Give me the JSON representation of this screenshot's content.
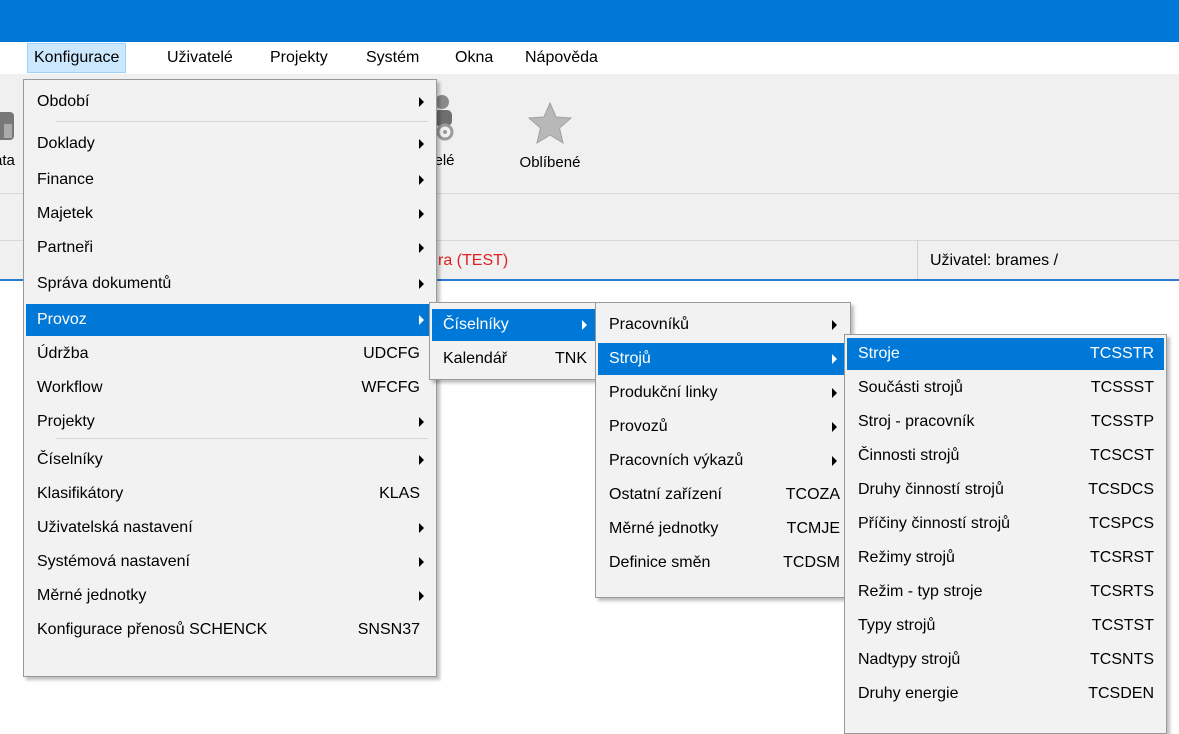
{
  "menubar": {
    "items": [
      "Konfigurace",
      "Uživatelé",
      "Projekty",
      "Systém",
      "Okna",
      "Nápověda"
    ]
  },
  "toolbar": {
    "left_partial": "ata",
    "users_partial": "atelé",
    "favorites": "Oblíbené"
  },
  "status": {
    "company_partial": "ra (TEST)",
    "user": "Uživatel: brames /"
  },
  "menu1": [
    {
      "label": "Období",
      "submenu": true
    },
    {
      "label": "Doklady",
      "submenu": true
    },
    {
      "label": "Finance",
      "submenu": true
    },
    {
      "label": "Majetek",
      "submenu": true
    },
    {
      "label": "Partneři",
      "submenu": true
    },
    {
      "label": "Správa dokumentů",
      "submenu": true
    },
    {
      "label": "Provoz",
      "submenu": true,
      "selected": true
    },
    {
      "label": "Údržba",
      "shortcut": "UDCFG"
    },
    {
      "label": "Workflow",
      "shortcut": "WFCFG"
    },
    {
      "label": "Projekty",
      "submenu": true
    },
    {
      "label": "Číselníky",
      "submenu": true
    },
    {
      "label": "Klasifikátory",
      "shortcut": "KLAS"
    },
    {
      "label": "Uživatelská nastavení",
      "submenu": true
    },
    {
      "label": "Systémová nastavení",
      "submenu": true
    },
    {
      "label": "Měrné jednotky",
      "submenu": true
    },
    {
      "label": "Konfigurace přenosů SCHENCK",
      "shortcut": "SNSN37"
    }
  ],
  "menu2": [
    {
      "label": "Číselníky",
      "submenu": true,
      "selected": true
    },
    {
      "label": "Kalendář",
      "shortcut": "TNK"
    }
  ],
  "menu3": [
    {
      "label": "Pracovníků",
      "submenu": true
    },
    {
      "label": "Strojů",
      "submenu": true,
      "selected": true
    },
    {
      "label": "Produkční linky",
      "submenu": true
    },
    {
      "label": "Provozů",
      "submenu": true
    },
    {
      "label": "Pracovních výkazů",
      "submenu": true
    },
    {
      "label": "Ostatní zařízení",
      "shortcut": "TCOZA"
    },
    {
      "label": "Měrné jednotky",
      "shortcut": "TCMJE"
    },
    {
      "label": "Definice směn",
      "shortcut": "TCDSM"
    }
  ],
  "menu4": [
    {
      "label": "Stroje",
      "shortcut": "TCSSTR",
      "selected": true
    },
    {
      "label": "Součásti strojů",
      "shortcut": "TCSSST"
    },
    {
      "label": "Stroj - pracovník",
      "shortcut": "TCSSTP"
    },
    {
      "label": "Činnosti strojů",
      "shortcut": "TCSCST"
    },
    {
      "label": "Druhy činností strojů",
      "shortcut": "TCSDCS"
    },
    {
      "label": "Příčiny činností strojů",
      "shortcut": "TCSPCS"
    },
    {
      "label": "Režimy strojů",
      "shortcut": "TCSRST"
    },
    {
      "label": "Režim - typ stroje",
      "shortcut": "TCSRTS"
    },
    {
      "label": "Typy strojů",
      "shortcut": "TCSTST"
    },
    {
      "label": "Nadtypy strojů",
      "shortcut": "TCSNTS"
    },
    {
      "label": "Druhy energie",
      "shortcut": "TCSDEN"
    }
  ]
}
